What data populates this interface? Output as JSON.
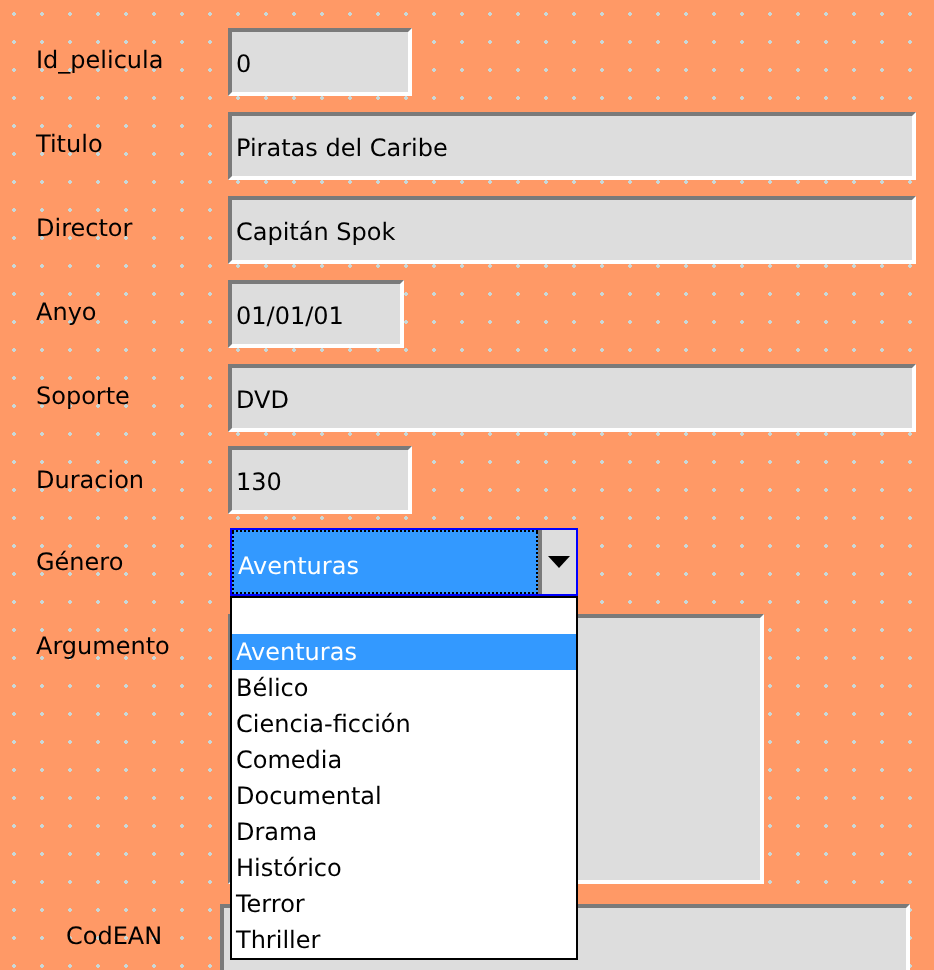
{
  "fields": [
    {
      "label": "Id_pelicula",
      "kind": "text",
      "value": "0"
    },
    {
      "label": "Titulo",
      "kind": "text",
      "value": "Piratas del Caribe"
    },
    {
      "label": "Director",
      "kind": "text",
      "value": "Capitán Spok"
    },
    {
      "label": "Anyo",
      "kind": "text",
      "value": "01/01/01"
    },
    {
      "label": "Soporte",
      "kind": "text",
      "value": "DVD"
    },
    {
      "label": "Duracion",
      "kind": "text",
      "value": "130"
    },
    {
      "label": "Género",
      "kind": "combo",
      "value": "Aventuras",
      "expanded": true,
      "options": [
        {
          "label": "Aventuras",
          "selected": true
        },
        {
          "label": "Bélico",
          "selected": false
        },
        {
          "label": "Ciencia-ficción",
          "selected": false
        },
        {
          "label": "Comedia",
          "selected": false
        },
        {
          "label": "Documental",
          "selected": false
        },
        {
          "label": "Drama",
          "selected": false
        },
        {
          "label": "Histórico",
          "selected": false
        },
        {
          "label": "Terror",
          "selected": false
        },
        {
          "label": "Thriller",
          "selected": false
        }
      ]
    },
    {
      "label": "Argumento",
      "kind": "textarea"
    },
    {
      "label": "CodEAN",
      "kind": "text"
    }
  ]
}
